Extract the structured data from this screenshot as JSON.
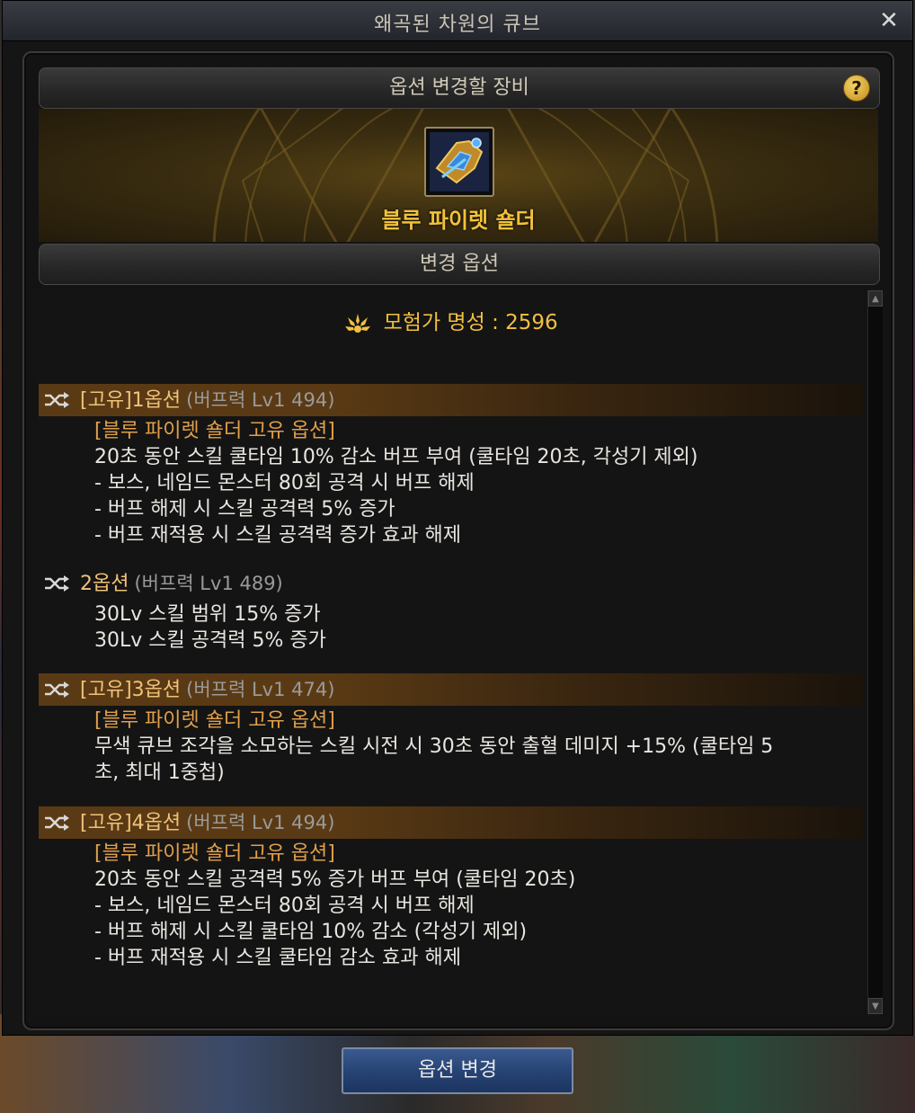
{
  "window": {
    "title": "왜곡된 차원의 큐브",
    "close_label": "✕"
  },
  "equip_section": {
    "header": "옵션 변경할 장비",
    "help_label": "?",
    "item_name": "블루 파이렛 숄더",
    "item_icon": "shoulder-armor-icon"
  },
  "change_section": {
    "header": "변경 옵션",
    "fame_label": "모험가 명성 : 2596",
    "fame_icon": "fame-emblem-icon",
    "options": [
      {
        "title": "[고유]1옵션",
        "sub": "(버프력 Lv1 494)",
        "highlighted": true,
        "lines": [
          {
            "text": "[블루 파이렛 숄더 고유 옵션]",
            "origin": true
          },
          {
            "text": "20초 동안 스킬 쿨타임 10% 감소 버프 부여 (쿨타임 20초, 각성기 제외)",
            "origin": false
          },
          {
            "text": "- 보스, 네임드 몬스터 80회 공격 시 버프 해제",
            "origin": false
          },
          {
            "text": "- 버프 해제 시 스킬 공격력 5% 증가",
            "origin": false
          },
          {
            "text": "- 버프 재적용 시 스킬 공격력 증가 효과 해제",
            "origin": false
          }
        ]
      },
      {
        "title": "2옵션",
        "sub": "(버프력 Lv1 489)",
        "highlighted": false,
        "lines": [
          {
            "text": "30Lv 스킬 범위 15% 증가",
            "origin": false
          },
          {
            "text": "30Lv 스킬 공격력 5% 증가",
            "origin": false
          }
        ]
      },
      {
        "title": "[고유]3옵션",
        "sub": "(버프력 Lv1 474)",
        "highlighted": true,
        "lines": [
          {
            "text": "[블루 파이렛 숄더 고유 옵션]",
            "origin": true
          },
          {
            "text": "무색 큐브 조각을 소모하는 스킬 시전 시 30초 동안 출혈 데미지 +15% (쿨타임 5",
            "origin": false
          },
          {
            "text": "초, 최대 1중첩)",
            "origin": false
          }
        ]
      },
      {
        "title": "[고유]4옵션",
        "sub": "(버프력 Lv1 494)",
        "highlighted": true,
        "lines": [
          {
            "text": "[블루 파이렛 숄더 고유 옵션]",
            "origin": true
          },
          {
            "text": "20초 동안 스킬 공격력 5% 증가 버프 부여 (쿨타임 20초)",
            "origin": false
          },
          {
            "text": "- 보스, 네임드 몬스터 80회 공격 시 버프 해제",
            "origin": false
          },
          {
            "text": "- 버프 해제 시 스킬 쿨타임 10% 감소 (각성기 제외)",
            "origin": false
          },
          {
            "text": "- 버프 재적용 시 스킬 쿨타임 감소 효과 해제",
            "origin": false
          }
        ]
      }
    ]
  },
  "footer": {
    "change_button": "옵션 변경"
  }
}
